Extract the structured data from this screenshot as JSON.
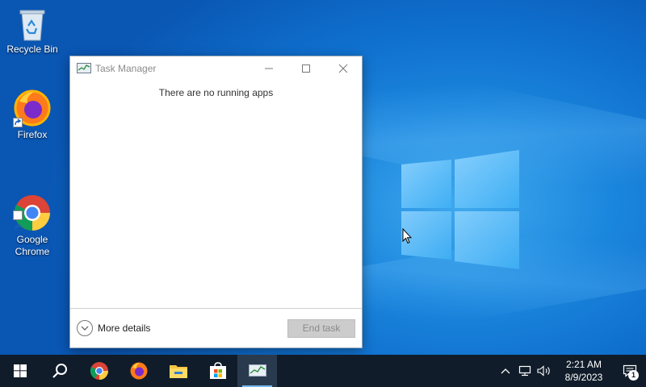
{
  "desktop": {
    "icons": [
      {
        "label": "Recycle Bin"
      },
      {
        "label": "Firefox"
      },
      {
        "label": "Google\nChrome"
      }
    ]
  },
  "task_manager": {
    "title": "Task Manager",
    "message": "There are no running apps",
    "more_details_label": "More details",
    "end_task_label": "End task"
  },
  "taskbar": {
    "apps": [
      "start-icon",
      "search-icon",
      "chrome-icon",
      "firefox-icon",
      "file-explorer-icon",
      "microsoft-store-icon",
      "task-manager-icon"
    ],
    "active_app": "task-manager-icon",
    "clock": {
      "time": "2:21 AM",
      "date": "8/9/2023"
    },
    "notification_count": "1"
  },
  "colors": {
    "taskbar_bg": "#101c2a",
    "desktop_blue": "#0f6fcd",
    "active_indicator": "#76b9ed"
  }
}
